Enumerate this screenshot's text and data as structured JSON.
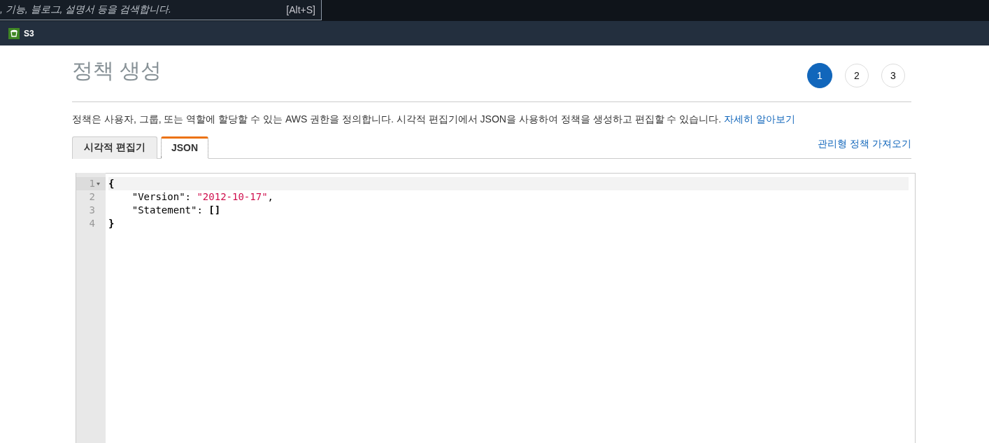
{
  "search": {
    "placeholder": ", 기능, 블로그, 설명서 등을 검색합니다.",
    "shortcut": "[Alt+S]"
  },
  "service_bar": {
    "service": "S3"
  },
  "page": {
    "title": "정책 생성",
    "steps": [
      {
        "label": "1",
        "selected": true
      },
      {
        "label": "2",
        "selected": false
      },
      {
        "label": "3",
        "selected": false
      }
    ],
    "description": "정책은 사용자, 그룹, 또는 역할에 할당할 수 있는 AWS 권한을 정의합니다. 시각적 편집기에서 JSON을 사용하여 정책을 생성하고 편집할 수 있습니다.",
    "learn_more": "자세히 알아보기",
    "tabs": [
      {
        "label": "시각적 편집기",
        "selected": false
      },
      {
        "label": "JSON",
        "selected": true
      }
    ],
    "import_link": "관리형 정책 가져오기"
  },
  "editor": {
    "lines": [
      {
        "number": "1",
        "active": true,
        "foldable": true,
        "segments": [
          {
            "kind": "punct",
            "text": "{"
          }
        ]
      },
      {
        "number": "2",
        "active": false,
        "foldable": false,
        "segments": [
          {
            "kind": "key",
            "text": "    \"Version\""
          },
          {
            "kind": "plain",
            "text": ": "
          },
          {
            "kind": "string",
            "text": "\"2012-10-17\""
          },
          {
            "kind": "plain",
            "text": ","
          }
        ]
      },
      {
        "number": "3",
        "active": false,
        "foldable": false,
        "segments": [
          {
            "kind": "key",
            "text": "    \"Statement\""
          },
          {
            "kind": "plain",
            "text": ": "
          },
          {
            "kind": "punct",
            "text": "[]"
          }
        ]
      },
      {
        "number": "4",
        "active": false,
        "foldable": false,
        "segments": [
          {
            "kind": "punct",
            "text": "}"
          }
        ]
      }
    ]
  }
}
